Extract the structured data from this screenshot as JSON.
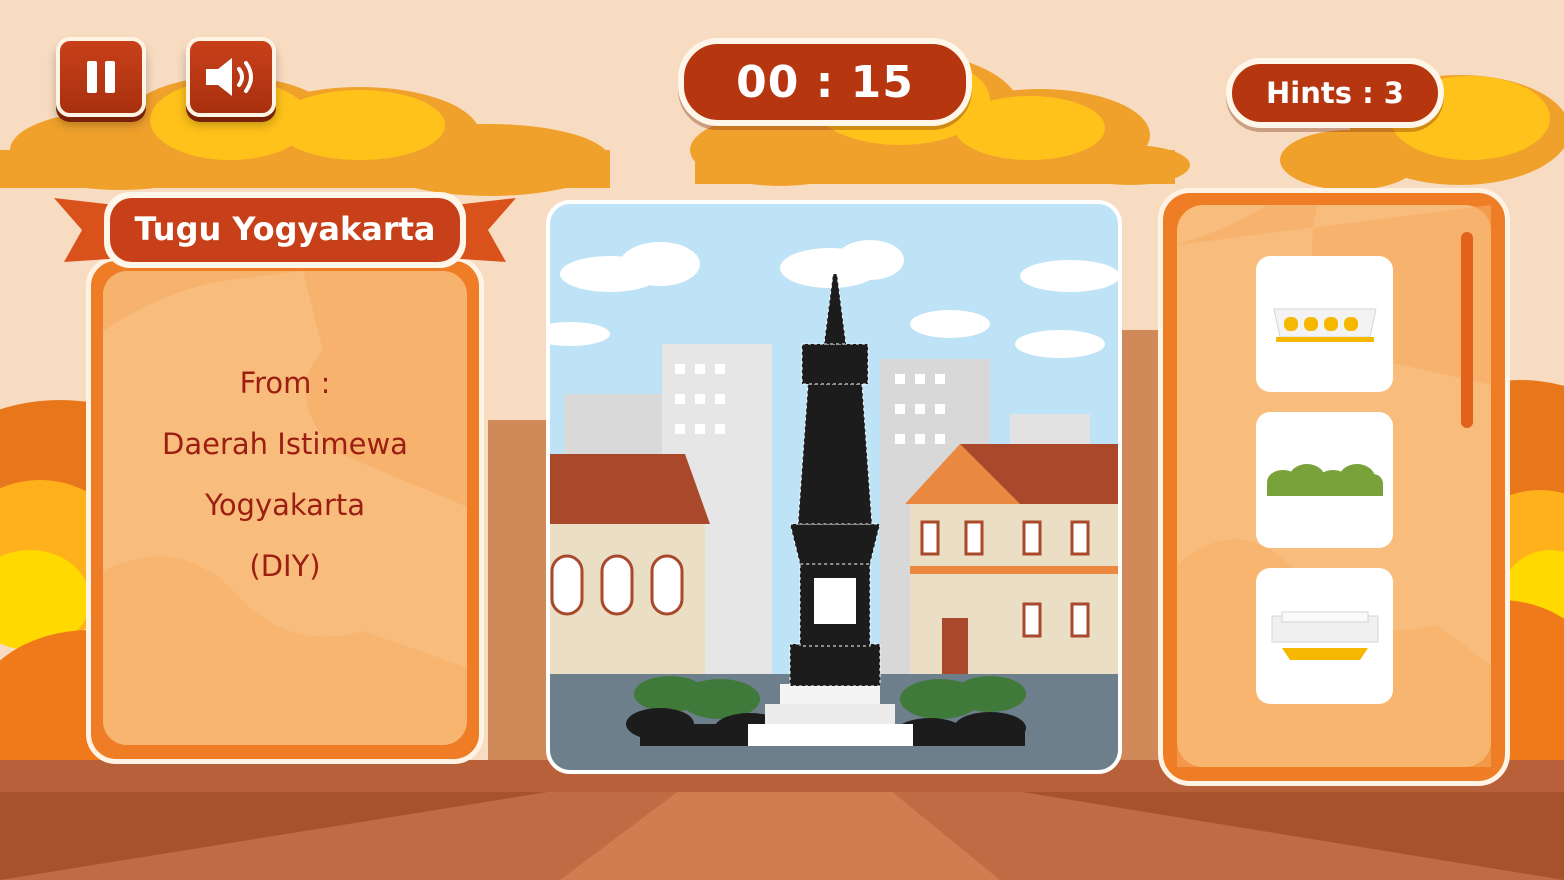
{
  "hud": {
    "timer": "00 : 15",
    "hints": "Hints : 3",
    "pause_icon": "pause-icon",
    "sound_icon": "speaker-volume-icon"
  },
  "landmark": {
    "name": "Tugu Yogyakarta",
    "from_label": "From :",
    "origin_lines": [
      "Daerah Istimewa",
      "Yogyakarta",
      "(DIY)"
    ]
  },
  "pieces": [
    {
      "icon": "monument-crown-piece-icon"
    },
    {
      "icon": "hedge-bush-piece-icon"
    },
    {
      "icon": "monument-base-piece-icon"
    }
  ],
  "colors": {
    "accent": "#b5360f",
    "panel_orange": "#ef7d25",
    "panel_light": "#f8bc7c",
    "text_dark_red": "#9c1d12"
  }
}
